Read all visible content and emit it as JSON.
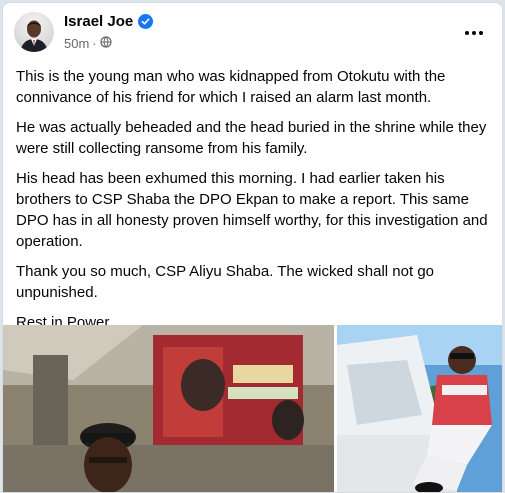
{
  "post": {
    "author": "Israel Joe",
    "time": "50m",
    "separator": "·",
    "paragraphs": [
      "This is the young man who was kidnapped from Otokutu with the connivance of his friend for which I raised an alarm last month.",
      "He was actually beheaded and the head buried in the shrine while they were still collecting ransome from his family.",
      "His head has been exhumed this morning. I had earlier taken his brothers to CSP Shaba the DPO Ekpan to make a report. This same DPO has in all honesty proven himself worthy, for this investigation and operation.",
      "Thank you so much, CSP Aliyu Shaba. The wicked shall not go unpunished.",
      "Rest in Power..."
    ]
  },
  "icons": {
    "verified": "verified-badge-icon",
    "audience": "globe-icon",
    "more": "more-options-icon"
  },
  "colors": {
    "verified_blue": "#1877f2",
    "meta_gray": "#65676b",
    "text": "#050505"
  }
}
